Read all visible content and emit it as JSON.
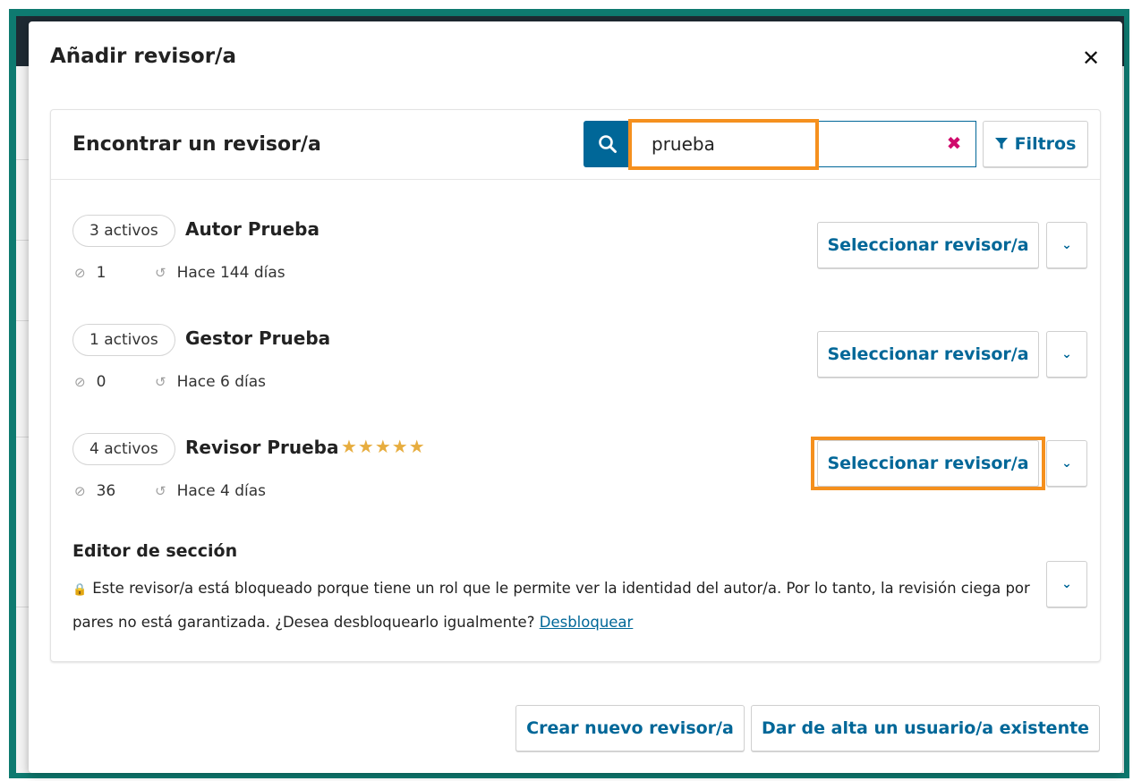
{
  "modal": {
    "title": "Añadir revisor/a",
    "close_icon": "close-icon"
  },
  "panel": {
    "title": "Encontrar un revisor/a",
    "search": {
      "value": "prueba",
      "search_icon": "search-icon",
      "clear_icon": "clear-icon"
    },
    "filters_label": "Filtros"
  },
  "reviewers": [
    {
      "active": "3 activos",
      "name": "Autor Prueba",
      "stars": "",
      "completed": "1",
      "last_activity": "Hace 144 días",
      "select_label": "Seleccionar revisor/a"
    },
    {
      "active": "1 activos",
      "name": "Gestor Prueba",
      "stars": "",
      "completed": "0",
      "last_activity": "Hace 6 días",
      "select_label": "Seleccionar revisor/a"
    },
    {
      "active": "4 activos",
      "name": "Revisor Prueba",
      "stars": "★★★★★",
      "rating": 5,
      "completed": "36",
      "last_activity": "Hace 4 días",
      "select_label": "Seleccionar revisor/a"
    }
  ],
  "blocked": {
    "title": "Editor de sección",
    "message": "Este revisor/a está bloqueado porque tiene un rol que le permite ver la identidad del autor/a. Por lo tanto, la revisión ciega por pares no está garantizada. ¿Desea desbloquearlo igualmente?",
    "unlock_label": "Desbloquear"
  },
  "footer": {
    "create_label": "Crear nuevo revisor/a",
    "enroll_label": "Dar de alta un usuario/a existente"
  },
  "colors": {
    "frame": "#0e7a70",
    "accent": "#006798",
    "highlight": "#f5901e",
    "clear": "#d00a6c",
    "stars": "#e7ad3f"
  }
}
